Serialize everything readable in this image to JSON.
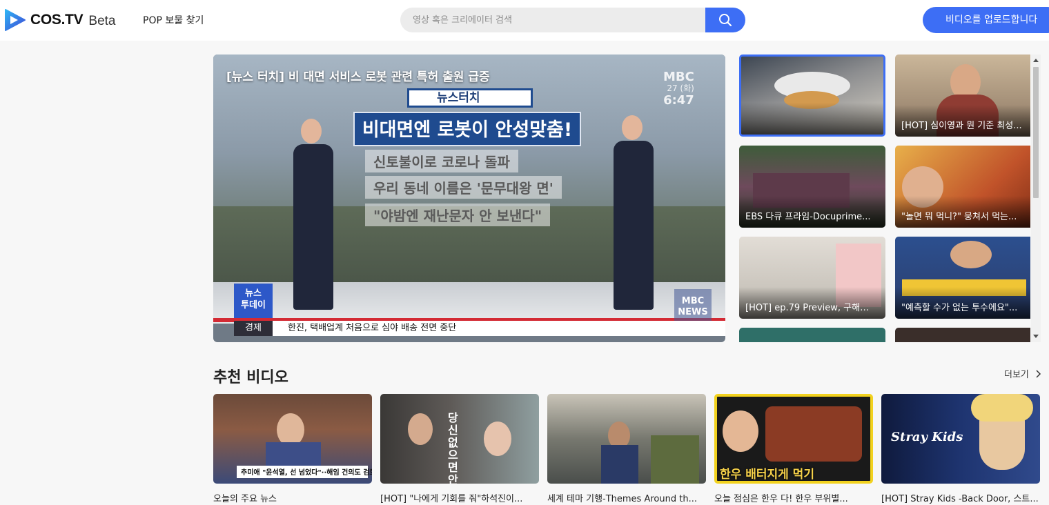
{
  "header": {
    "logo_text": "COS.TV",
    "logo_beta": "Beta",
    "nav_link": "POP 보물 찾기",
    "search_placeholder": "영상 혹은 크리에이터 검색",
    "upload_label": "비디오를 업로드합니다",
    "accent_color": "#3d6ef5"
  },
  "hero": {
    "title": "[뉴스 터치] 비 대면 서비스 로봇 관련 특허 출원 급증",
    "board_tag": "뉴스터치",
    "board_main": "비대면엔 로봇이 안성맞춤!",
    "board_lines": [
      "신토불이로 코로나 돌파",
      "우리 동네 이름은 '문무대왕 면'",
      "\"야밤엔 재난문자 안 보낸다\""
    ],
    "channel": "MBC",
    "date_small": "27 (화)",
    "time": "6:47",
    "news_box": "뉴스\n투데이",
    "ticker_category": "경제",
    "ticker_text": "한진, 택배업계 처음으로 심야 배송 전면 중단",
    "mbc_news": "MBC\nNEWS"
  },
  "side_videos": [
    {
      "caption": ""
    },
    {
      "caption": "[HOT] 심이영과 뭔 기준 최성..."
    },
    {
      "caption": "EBS 다큐 프라임-Docuprime..."
    },
    {
      "caption": "\"놀면 뭐 먹니?\" 뭉쳐서 먹는..."
    },
    {
      "caption": "[HOT] ep.79 Preview, 구해줘..."
    },
    {
      "caption": "\"예측할 수가 없는 투수에요\"..."
    }
  ],
  "recommended": {
    "title": "추천 비디오",
    "more_label": "더보기",
    "items": [
      {
        "title": "오늘의 주요 뉴스",
        "overlay": "추미애 \"윤석열, 선 넘었다\"··해임 건의도 검토"
      },
      {
        "title": "[HOT] \"나에게 기회를 줘\"하석진이...",
        "overlay": "당신 없으면 안돼"
      },
      {
        "title": "세계 테마 기행-Themes Around th...",
        "overlay": ""
      },
      {
        "title": "오늘 점심은 한우 다! 한우 부위별...",
        "overlay": "한우 배터지게 먹기"
      },
      {
        "title": "[HOT] Stray Kids -Back Door, 스트...",
        "overlay": "Stray Kids"
      }
    ]
  }
}
